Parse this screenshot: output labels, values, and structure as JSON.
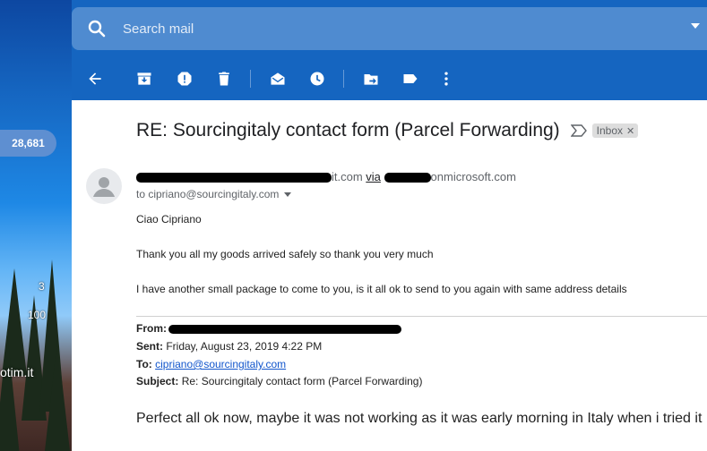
{
  "search": {
    "placeholder": "Search mail"
  },
  "sidebar": {
    "mail_count": "28,681",
    "counts": [
      "3",
      "100"
    ],
    "partial_domain": "otim.it"
  },
  "toolbar": {
    "icons": [
      "back-arrow",
      "archive",
      "report-spam",
      "delete",
      "mark-unread",
      "snooze",
      "move-to",
      "labels",
      "more"
    ]
  },
  "message": {
    "subject": "RE: Sourcingitaly contact form (Parcel Forwarding)",
    "label": "Inbox",
    "sender_domain_tail": "it.com",
    "via": "via",
    "via_domain_tail": "onmicrosoft.com",
    "to": "to cipriano@sourcingitaly.com",
    "greeting": "Ciao Cipriano",
    "para1": "Thank you all my goods arrived safely so thank you very much",
    "para2": "I have another small package to come to you, is it all ok to send to you again with same address details",
    "quoted": {
      "from_label": "From:",
      "sent_label": "Sent:",
      "sent_value": "Friday, August 23, 2019 4:22 PM",
      "to_label": "To:",
      "to_value": "cipriano@sourcingitaly.com",
      "subject_label": "Subject:",
      "subject_value": "Re: Sourcingitaly contact form (Parcel Forwarding)"
    },
    "big_line": "Perfect all ok now, maybe it was not working as it was early morning in Italy when i tried it"
  },
  "colors": {
    "toolbar_bg": "#1565c0",
    "link": "#1155cc",
    "label_bg": "#dddddd"
  }
}
